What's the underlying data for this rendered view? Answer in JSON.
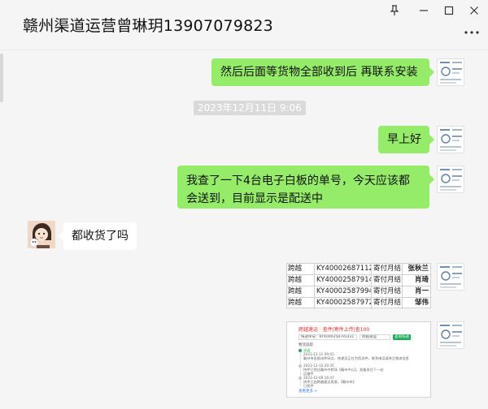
{
  "window": {
    "title": "赣州渠道运营曾琳玥13907079823",
    "pin_icon": "pin-icon",
    "minimize_icon": "minimize-icon",
    "maximize_icon": "maximize-icon",
    "close_icon": "close-icon",
    "more_icon": "more-icon"
  },
  "messages": {
    "m1": "然后后面等货物全部收到后  再联系安装",
    "timestamp": "2023年12月11日 9:06",
    "m2": "早上好",
    "m3": "我查了一下4台电子白板的单号，今天应该都会送到，目前显示是配送中",
    "m4": "都收货了吗"
  },
  "table_image": {
    "rows": [
      {
        "c1": "跨越",
        "c2": "KY4000268711207",
        "c3": "寄付月结",
        "c4": "张秋兰"
      },
      {
        "c1": "跨越",
        "c2": "KY4000258791431",
        "c3": "寄付月结",
        "c4": "肖琦"
      },
      {
        "c1": "跨越",
        "c2": "KY4000258799458",
        "c3": "寄付月结",
        "c4": "肖一"
      },
      {
        "c1": "跨越",
        "c2": "KY4000258797266",
        "c3": "寄付月结",
        "c4": "邹伟"
      }
    ]
  },
  "tracking_image": {
    "header": "跨越速运 · 查件|寄件上传|查100",
    "query_label": "快递单号：",
    "query_value": "KY4000258791431",
    "carrier": "跨越速运",
    "button": "查询快递",
    "section": "物流追踪",
    "items": [
      {
        "status": "派送",
        "time": "2023-12-11 09:02",
        "text": "赣州市宏图派件网点，快递员正在为您派件，联系电话请关注物流信息"
      },
      {
        "status": "运输中",
        "time": "2023-12-10 20:35",
        "text": "快件已到达赣州中转场【赣州中心】，准备发往下一站"
      },
      {
        "status": "已揽件",
        "time": "2023-12-09 16:47",
        "text": "快件已由跨越速运揽收，【赣州市】"
      }
    ],
    "footer": "查看更多 >"
  },
  "colors": {
    "my_bubble": "#95ec69",
    "other_bubble": "#ffffff",
    "background": "#f5f5f5",
    "timestamp_bg": "#dadada"
  }
}
